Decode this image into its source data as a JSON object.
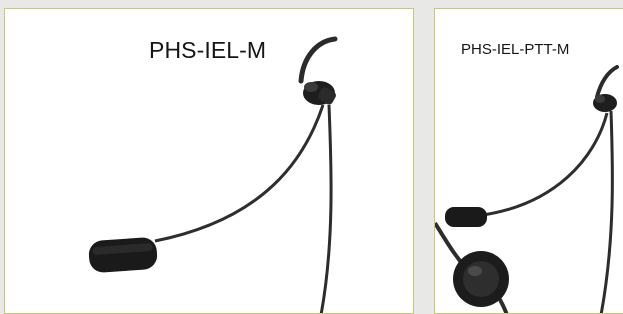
{
  "colors": {
    "page_background": "#e8e8e6",
    "card_background": "#ffffff",
    "card_border": "#c9c87e",
    "cable": "#2c2c2c",
    "foam": "#1a1a1a"
  },
  "products": [
    {
      "model": "PHS-IEL-M",
      "image": "headset-with-boom-mic"
    },
    {
      "model": "PHS-IEL-PTT-M",
      "image": "headset-with-boom-mic-and-ptt-button"
    }
  ]
}
